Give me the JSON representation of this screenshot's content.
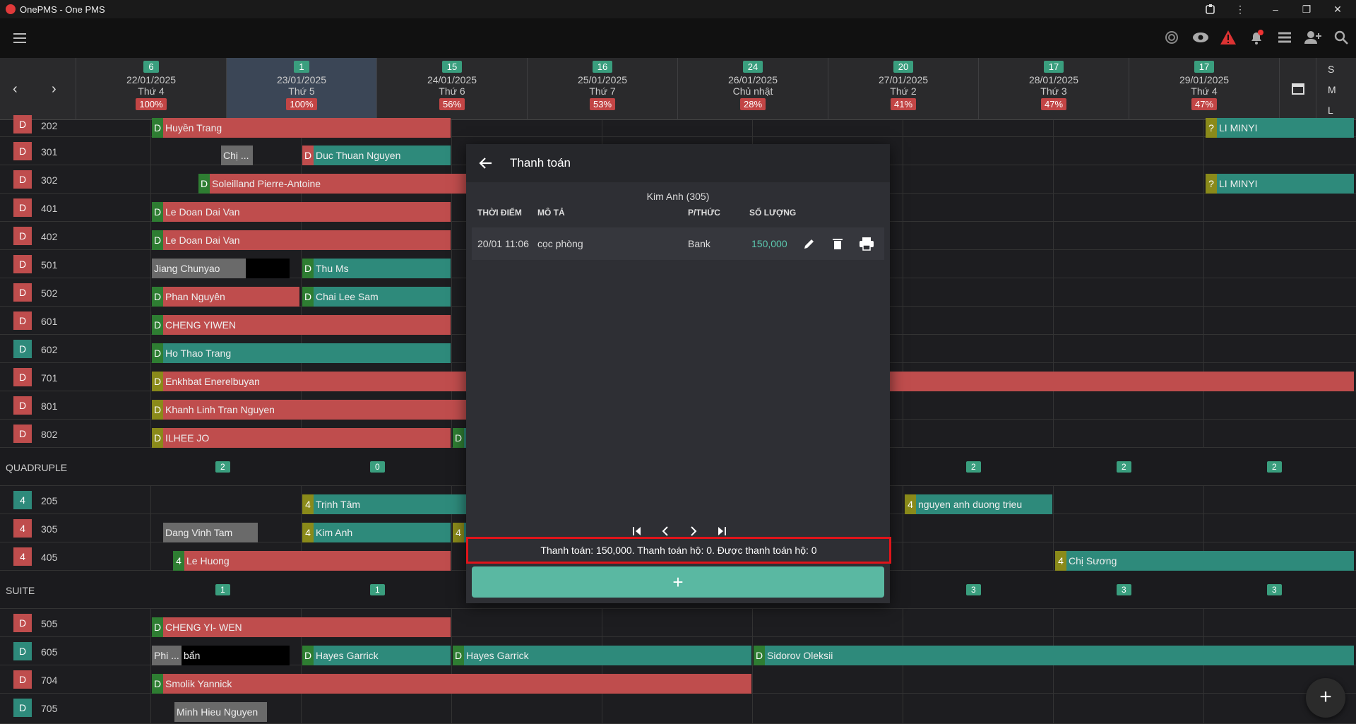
{
  "window": {
    "title": "OnePMS - One PMS"
  },
  "dates": [
    {
      "count": "6",
      "date": "22/01/2025",
      "weekday": "Thứ 4",
      "occupancy": "100%"
    },
    {
      "count": "1",
      "date": "23/01/2025",
      "weekday": "Thứ 5",
      "occupancy": "100%",
      "selected": true
    },
    {
      "count": "15",
      "date": "24/01/2025",
      "weekday": "Thứ 6",
      "occupancy": "56%"
    },
    {
      "count": "16",
      "date": "25/01/2025",
      "weekday": "Thứ 7",
      "occupancy": "53%"
    },
    {
      "count": "24",
      "date": "26/01/2025",
      "weekday": "Chủ nhật",
      "occupancy": "28%"
    },
    {
      "count": "20",
      "date": "27/01/2025",
      "weekday": "Thứ 2",
      "occupancy": "41%"
    },
    {
      "count": "17",
      "date": "28/01/2025",
      "weekday": "Thứ 3",
      "occupancy": "47%"
    },
    {
      "count": "17",
      "date": "29/01/2025",
      "weekday": "Thứ 4",
      "occupancy": "47%"
    }
  ],
  "view_modes": [
    "S",
    "M",
    "L"
  ],
  "rooms": [
    {
      "badge": "D",
      "num": "202"
    },
    {
      "badge": "D",
      "num": "301"
    },
    {
      "badge": "D",
      "num": "302"
    },
    {
      "badge": "D",
      "num": "401"
    },
    {
      "badge": "D",
      "num": "402"
    },
    {
      "badge": "D",
      "num": "501"
    },
    {
      "badge": "D",
      "num": "502"
    },
    {
      "badge": "D",
      "num": "601"
    },
    {
      "badge": "D",
      "num": "602"
    },
    {
      "badge": "D",
      "num": "701"
    },
    {
      "badge": "D",
      "num": "801"
    },
    {
      "badge": "D",
      "num": "802"
    },
    {
      "group": "QUADRUPLE",
      "counts": [
        "2",
        "0",
        "",
        "",
        "",
        "2",
        "2",
        "2"
      ]
    },
    {
      "badge": "4",
      "num": "205"
    },
    {
      "badge": "4",
      "num": "305"
    },
    {
      "badge": "4",
      "num": "405"
    },
    {
      "group": "SUITE",
      "counts": [
        "1",
        "1",
        "",
        "",
        "",
        "3",
        "3",
        "3"
      ]
    },
    {
      "badge": "D",
      "num": "505"
    },
    {
      "badge": "D",
      "num": "605"
    },
    {
      "badge": "D",
      "num": "704"
    },
    {
      "badge": "D",
      "num": "705"
    }
  ],
  "bookings": {
    "b202a": {
      "s": "D",
      "n": "Huyền Trang"
    },
    "b202b": {
      "s": "?",
      "n": "LI MINYI"
    },
    "b301a": {
      "s": "",
      "n": "Chị ..."
    },
    "b301b": {
      "s": "D",
      "n": "Duc Thuan Nguyen"
    },
    "b302a": {
      "s": "D",
      "n": "Soleilland Pierre-Antoine"
    },
    "b302b": {
      "s": "?",
      "n": "LI MINYI"
    },
    "b401": {
      "s": "D",
      "n": "Le Doan Dai Van"
    },
    "b402": {
      "s": "D",
      "n": "Le Doan Dai Van"
    },
    "b501a": {
      "s": "",
      "n": "Jiang Chunyao"
    },
    "b501b": {
      "s": "D",
      "n": "Thu Ms"
    },
    "b502a": {
      "s": "D",
      "n": "Phan Nguyên"
    },
    "b502b": {
      "s": "D",
      "n": "Chai Lee Sam"
    },
    "b601": {
      "s": "D",
      "n": "CHENG YIWEN"
    },
    "b602": {
      "s": "D",
      "n": "Ho Thao Trang"
    },
    "b701": {
      "s": "D",
      "n": "Enkhbat Enerelbuyan"
    },
    "b801": {
      "s": "D",
      "n": "Khanh Linh Tran Nguyen"
    },
    "b802a": {
      "s": "D",
      "n": "ILHEE JO"
    },
    "b802b": {
      "s": "D",
      "n": ""
    },
    "b205a": {
      "s": "4",
      "n": "Trịnh Tâm"
    },
    "b205b": {
      "s": "4",
      "n": "nguyen anh duong trieu"
    },
    "b305a": {
      "s": "",
      "n": "Dang Vinh Tam"
    },
    "b305b": {
      "s": "4",
      "n": "Kim Anh"
    },
    "b305c": {
      "s": "4",
      "n": ""
    },
    "b405a": {
      "s": "4",
      "n": "Le Huong"
    },
    "b405b": {
      "s": "4",
      "n": "Chị Sương"
    },
    "b505": {
      "s": "D",
      "n": "CHENG YI- WEN"
    },
    "b605a": {
      "s": "",
      "n": "Phi ..."
    },
    "b605x": {
      "s": "",
      "n": "bẩn"
    },
    "b605b": {
      "s": "D",
      "n": "Hayes Garrick"
    },
    "b605c": {
      "s": "D",
      "n": "Hayes Garrick"
    },
    "b605d": {
      "s": "D",
      "n": "Sidorov Oleksii"
    },
    "b704": {
      "s": "D",
      "n": "Smolik Yannick"
    },
    "b705": {
      "s": "",
      "n": "Minh Hieu Nguyen"
    }
  },
  "dialog": {
    "title": "Thanh toán",
    "guest": "Kim Anh (305)",
    "columns": {
      "time": "THỜI ĐIỂM",
      "desc": "MÔ TẢ",
      "method": "P/THỨC",
      "amount": "SỐ LƯỢNG"
    },
    "payments": [
      {
        "time": "20/01 11:06",
        "desc": "cọc phòng",
        "method": "Bank",
        "amount": "150,000"
      }
    ],
    "summary": "Thanh toán: 150,000. Thanh toán hộ:  0.  Được thanh toán hộ:  0",
    "add_label": "+"
  },
  "fab_label": "+",
  "colors": {
    "red": "#bf4d4d",
    "teal": "#2e8a7b",
    "accent": "#5ab8a2",
    "highlight": "#e0141a"
  }
}
